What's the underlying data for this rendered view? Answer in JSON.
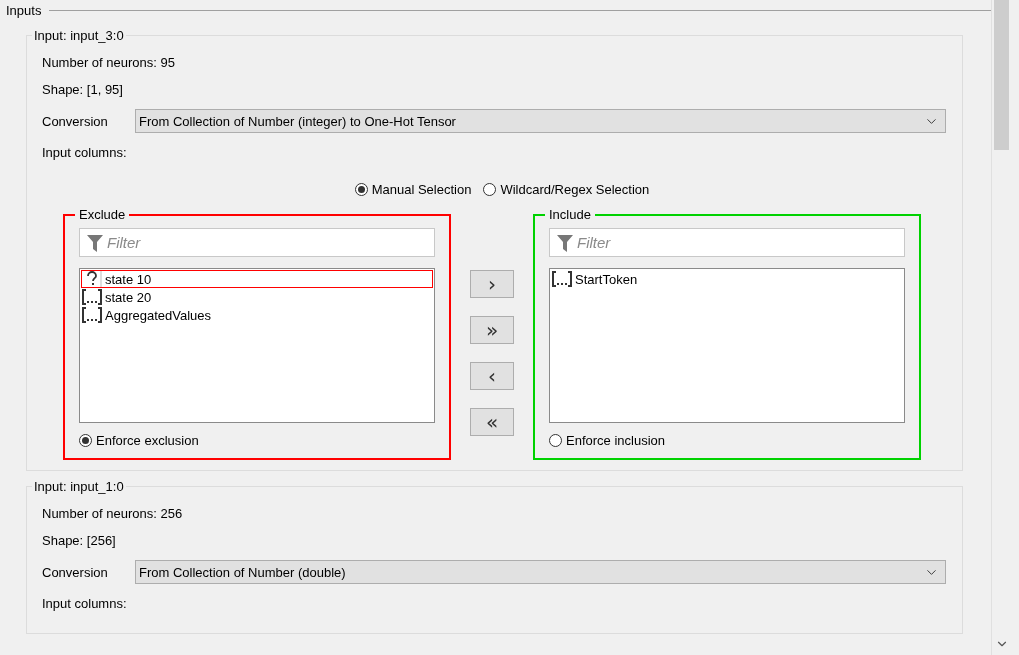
{
  "panel": {
    "title": "Inputs"
  },
  "inputs": [
    {
      "title": "Input: input_3:0",
      "neurons": "Number of neurons: 95",
      "shape": "Shape: [1, 95]",
      "conversion_label": "Conversion",
      "conversion": "From Collection of Number (integer) to One-Hot Tensor",
      "columns_label": "Input columns:",
      "selection_modes": [
        {
          "label": "Manual Selection",
          "selected": true
        },
        {
          "label": "Wildcard/Regex Selection",
          "selected": false
        }
      ],
      "exclude": {
        "title": "Exclude",
        "color": "#ff0000",
        "filter_placeholder": "Filter",
        "items": [
          {
            "label": "state 10",
            "kind": "unknown",
            "selected": true
          },
          {
            "label": "state 20",
            "kind": "collection",
            "selected": false
          },
          {
            "label": "AggregatedValues",
            "kind": "collection",
            "selected": false
          }
        ],
        "enforce": {
          "label": "Enforce exclusion",
          "selected": true
        }
      },
      "move_buttons": [
        "›",
        "»",
        "‹",
        "«"
      ],
      "include": {
        "title": "Include",
        "color": "#00d200",
        "filter_placeholder": "Filter",
        "items": [
          {
            "label": "StartToken",
            "kind": "collection",
            "selected": false
          }
        ],
        "enforce": {
          "label": "Enforce inclusion",
          "selected": false
        }
      }
    },
    {
      "title": "Input: input_1:0",
      "neurons": "Number of neurons: 256",
      "shape": "Shape: [256]",
      "conversion_label": "Conversion",
      "conversion": "From Collection of Number (double)",
      "columns_label": "Input columns:"
    }
  ]
}
